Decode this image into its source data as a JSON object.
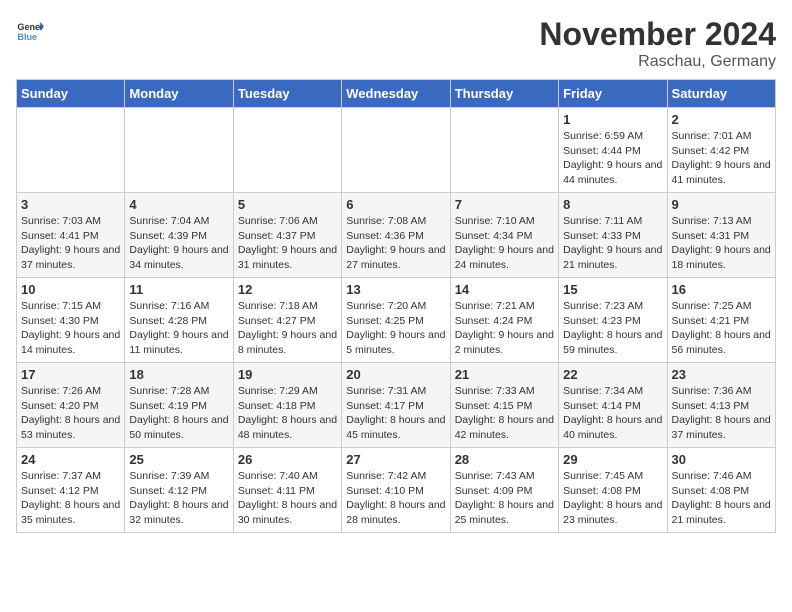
{
  "header": {
    "logo_general": "General",
    "logo_blue": "Blue",
    "month": "November 2024",
    "location": "Raschau, Germany"
  },
  "days_of_week": [
    "Sunday",
    "Monday",
    "Tuesday",
    "Wednesday",
    "Thursday",
    "Friday",
    "Saturday"
  ],
  "weeks": [
    [
      {
        "day": "",
        "info": ""
      },
      {
        "day": "",
        "info": ""
      },
      {
        "day": "",
        "info": ""
      },
      {
        "day": "",
        "info": ""
      },
      {
        "day": "",
        "info": ""
      },
      {
        "day": "1",
        "info": "Sunrise: 6:59 AM\nSunset: 4:44 PM\nDaylight: 9 hours and 44 minutes."
      },
      {
        "day": "2",
        "info": "Sunrise: 7:01 AM\nSunset: 4:42 PM\nDaylight: 9 hours and 41 minutes."
      }
    ],
    [
      {
        "day": "3",
        "info": "Sunrise: 7:03 AM\nSunset: 4:41 PM\nDaylight: 9 hours and 37 minutes."
      },
      {
        "day": "4",
        "info": "Sunrise: 7:04 AM\nSunset: 4:39 PM\nDaylight: 9 hours and 34 minutes."
      },
      {
        "day": "5",
        "info": "Sunrise: 7:06 AM\nSunset: 4:37 PM\nDaylight: 9 hours and 31 minutes."
      },
      {
        "day": "6",
        "info": "Sunrise: 7:08 AM\nSunset: 4:36 PM\nDaylight: 9 hours and 27 minutes."
      },
      {
        "day": "7",
        "info": "Sunrise: 7:10 AM\nSunset: 4:34 PM\nDaylight: 9 hours and 24 minutes."
      },
      {
        "day": "8",
        "info": "Sunrise: 7:11 AM\nSunset: 4:33 PM\nDaylight: 9 hours and 21 minutes."
      },
      {
        "day": "9",
        "info": "Sunrise: 7:13 AM\nSunset: 4:31 PM\nDaylight: 9 hours and 18 minutes."
      }
    ],
    [
      {
        "day": "10",
        "info": "Sunrise: 7:15 AM\nSunset: 4:30 PM\nDaylight: 9 hours and 14 minutes."
      },
      {
        "day": "11",
        "info": "Sunrise: 7:16 AM\nSunset: 4:28 PM\nDaylight: 9 hours and 11 minutes."
      },
      {
        "day": "12",
        "info": "Sunrise: 7:18 AM\nSunset: 4:27 PM\nDaylight: 9 hours and 8 minutes."
      },
      {
        "day": "13",
        "info": "Sunrise: 7:20 AM\nSunset: 4:25 PM\nDaylight: 9 hours and 5 minutes."
      },
      {
        "day": "14",
        "info": "Sunrise: 7:21 AM\nSunset: 4:24 PM\nDaylight: 9 hours and 2 minutes."
      },
      {
        "day": "15",
        "info": "Sunrise: 7:23 AM\nSunset: 4:23 PM\nDaylight: 8 hours and 59 minutes."
      },
      {
        "day": "16",
        "info": "Sunrise: 7:25 AM\nSunset: 4:21 PM\nDaylight: 8 hours and 56 minutes."
      }
    ],
    [
      {
        "day": "17",
        "info": "Sunrise: 7:26 AM\nSunset: 4:20 PM\nDaylight: 8 hours and 53 minutes."
      },
      {
        "day": "18",
        "info": "Sunrise: 7:28 AM\nSunset: 4:19 PM\nDaylight: 8 hours and 50 minutes."
      },
      {
        "day": "19",
        "info": "Sunrise: 7:29 AM\nSunset: 4:18 PM\nDaylight: 8 hours and 48 minutes."
      },
      {
        "day": "20",
        "info": "Sunrise: 7:31 AM\nSunset: 4:17 PM\nDaylight: 8 hours and 45 minutes."
      },
      {
        "day": "21",
        "info": "Sunrise: 7:33 AM\nSunset: 4:15 PM\nDaylight: 8 hours and 42 minutes."
      },
      {
        "day": "22",
        "info": "Sunrise: 7:34 AM\nSunset: 4:14 PM\nDaylight: 8 hours and 40 minutes."
      },
      {
        "day": "23",
        "info": "Sunrise: 7:36 AM\nSunset: 4:13 PM\nDaylight: 8 hours and 37 minutes."
      }
    ],
    [
      {
        "day": "24",
        "info": "Sunrise: 7:37 AM\nSunset: 4:12 PM\nDaylight: 8 hours and 35 minutes."
      },
      {
        "day": "25",
        "info": "Sunrise: 7:39 AM\nSunset: 4:12 PM\nDaylight: 8 hours and 32 minutes."
      },
      {
        "day": "26",
        "info": "Sunrise: 7:40 AM\nSunset: 4:11 PM\nDaylight: 8 hours and 30 minutes."
      },
      {
        "day": "27",
        "info": "Sunrise: 7:42 AM\nSunset: 4:10 PM\nDaylight: 8 hours and 28 minutes."
      },
      {
        "day": "28",
        "info": "Sunrise: 7:43 AM\nSunset: 4:09 PM\nDaylight: 8 hours and 25 minutes."
      },
      {
        "day": "29",
        "info": "Sunrise: 7:45 AM\nSunset: 4:08 PM\nDaylight: 8 hours and 23 minutes."
      },
      {
        "day": "30",
        "info": "Sunrise: 7:46 AM\nSunset: 4:08 PM\nDaylight: 8 hours and 21 minutes."
      }
    ]
  ]
}
